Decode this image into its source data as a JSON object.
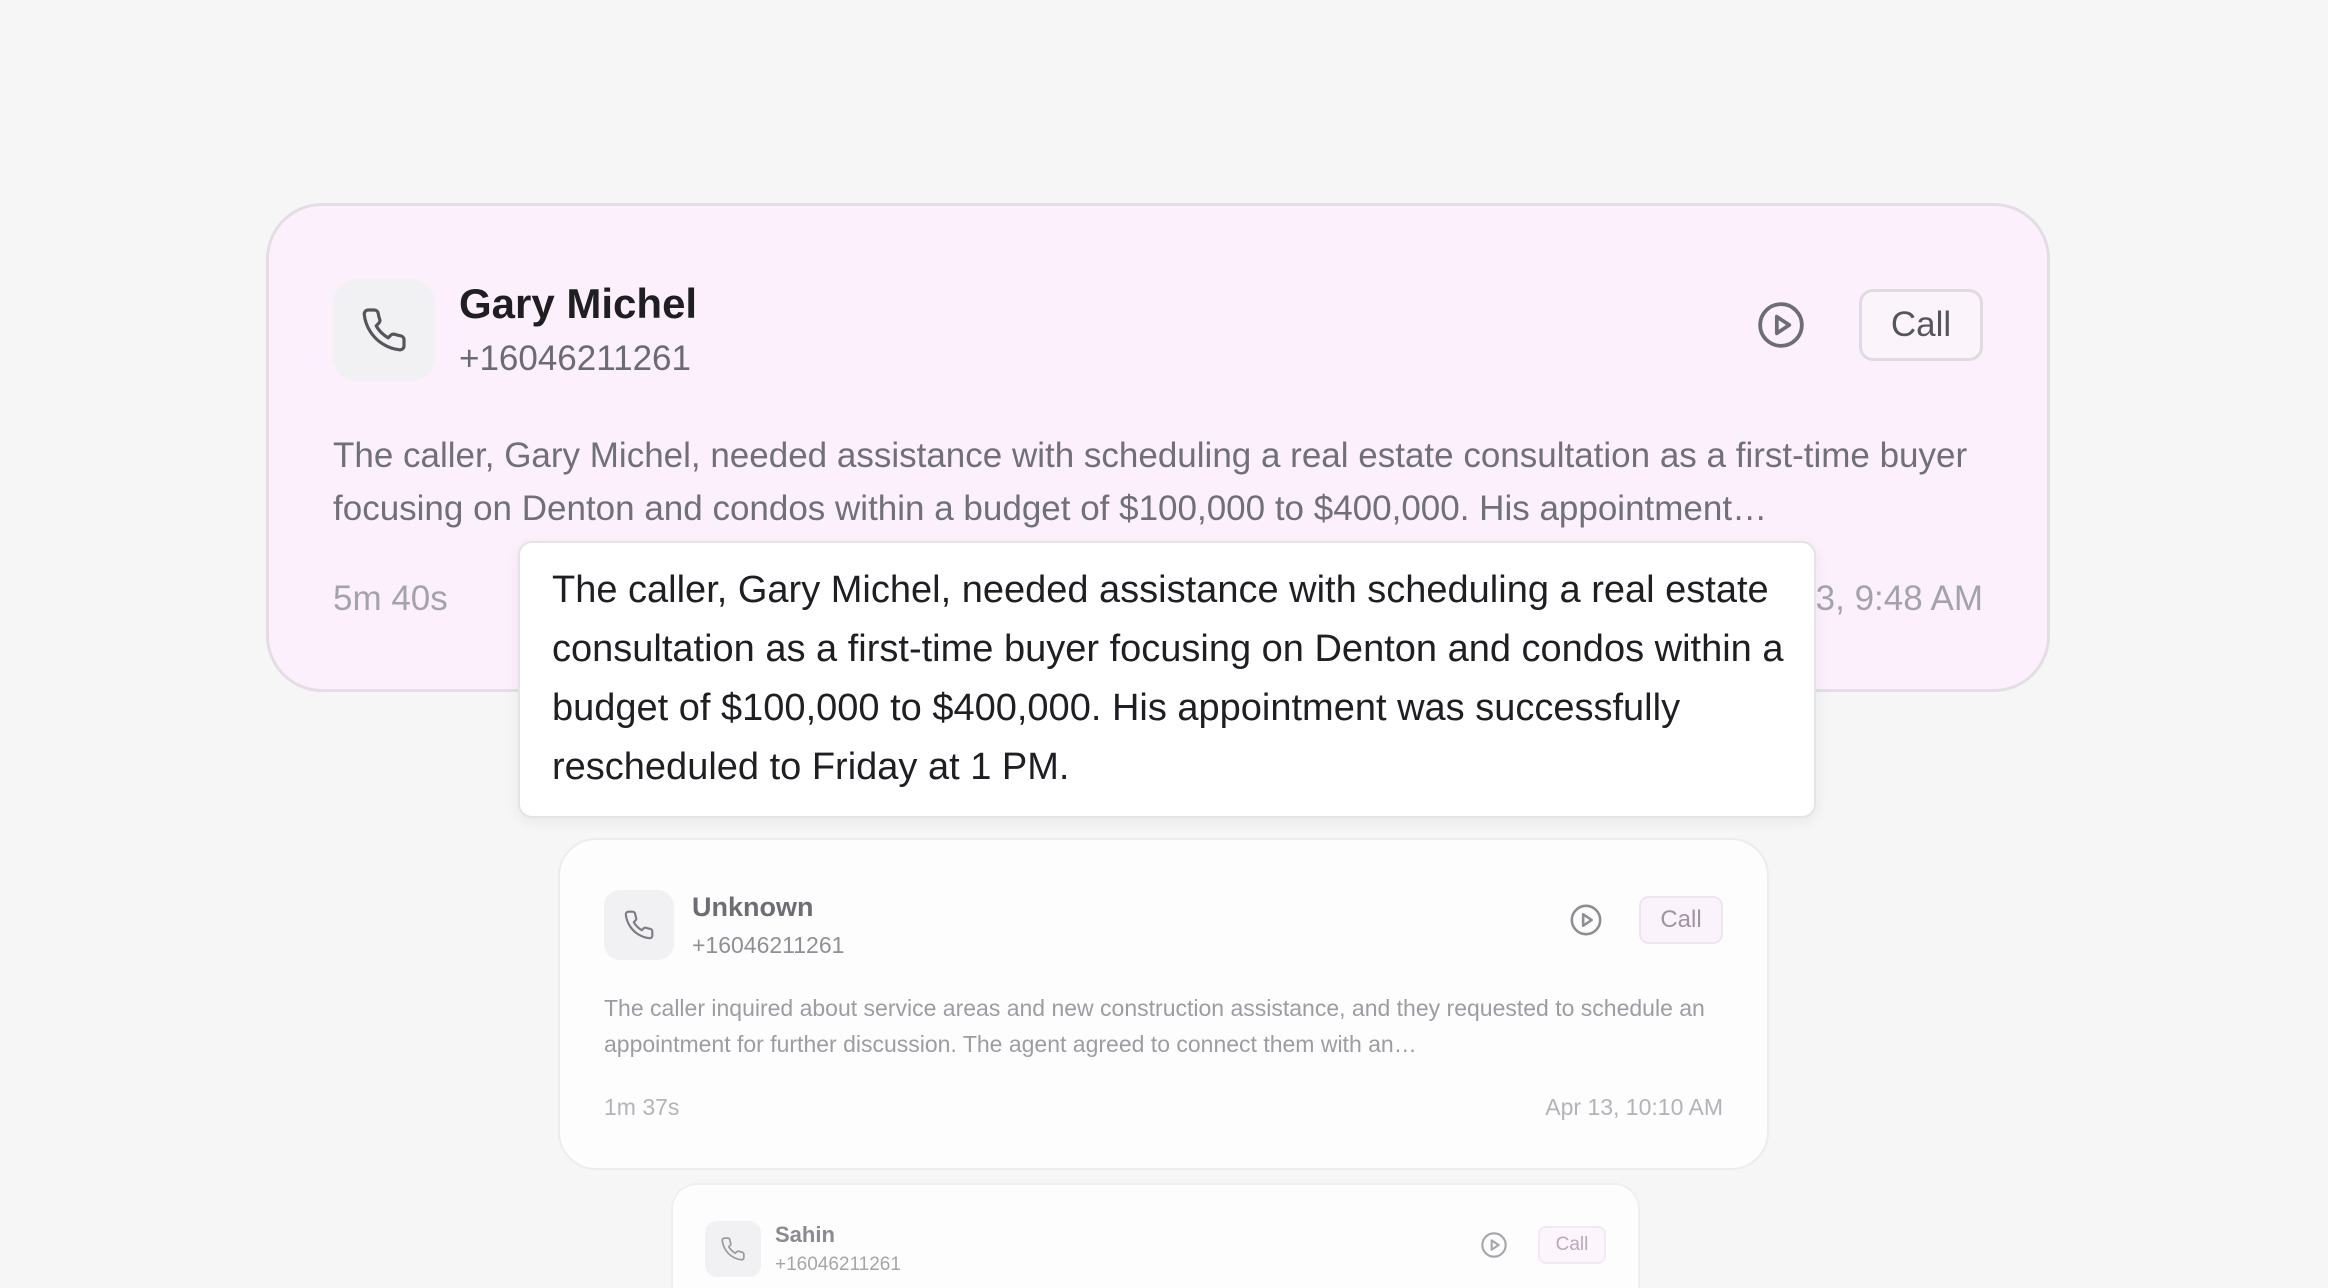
{
  "accent_color": "#fcf0fc",
  "cards": [
    {
      "name": "Gary Michel",
      "phone": "+16046211261",
      "summary": "The caller, Gary Michel, needed assistance with scheduling a real estate consultation as a first-time buyer focusing on Denton and condos within a budget of $100,000 to $400,000. His appointment…",
      "duration": "5m 40s",
      "timestamp": "3, 9:48 AM",
      "call_label": "Call",
      "icons": {
        "contact": "phone-icon",
        "play": "play-circle-icon"
      }
    },
    {
      "name": "Unknown",
      "phone": "+16046211261",
      "summary": "The caller inquired about service areas and new construction assistance, and they requested to schedule an appointment for further discussion. The agent agreed to connect them with an…",
      "duration": "1m 37s",
      "timestamp": "Apr 13, 10:10 AM",
      "call_label": "Call",
      "icons": {
        "contact": "phone-icon",
        "play": "play-circle-icon"
      }
    },
    {
      "name": "Sahin",
      "phone": "+16046211261",
      "call_label": "Call",
      "icons": {
        "contact": "phone-icon",
        "play": "play-circle-icon"
      }
    }
  ],
  "tooltip": {
    "text": "The caller, Gary Michel, needed assistance with scheduling a real estate consultation as a first-time buyer focusing on Denton and condos within a budget of $100,000 to $400,000. His appointment was successfully rescheduled to Friday at 1 PM."
  }
}
